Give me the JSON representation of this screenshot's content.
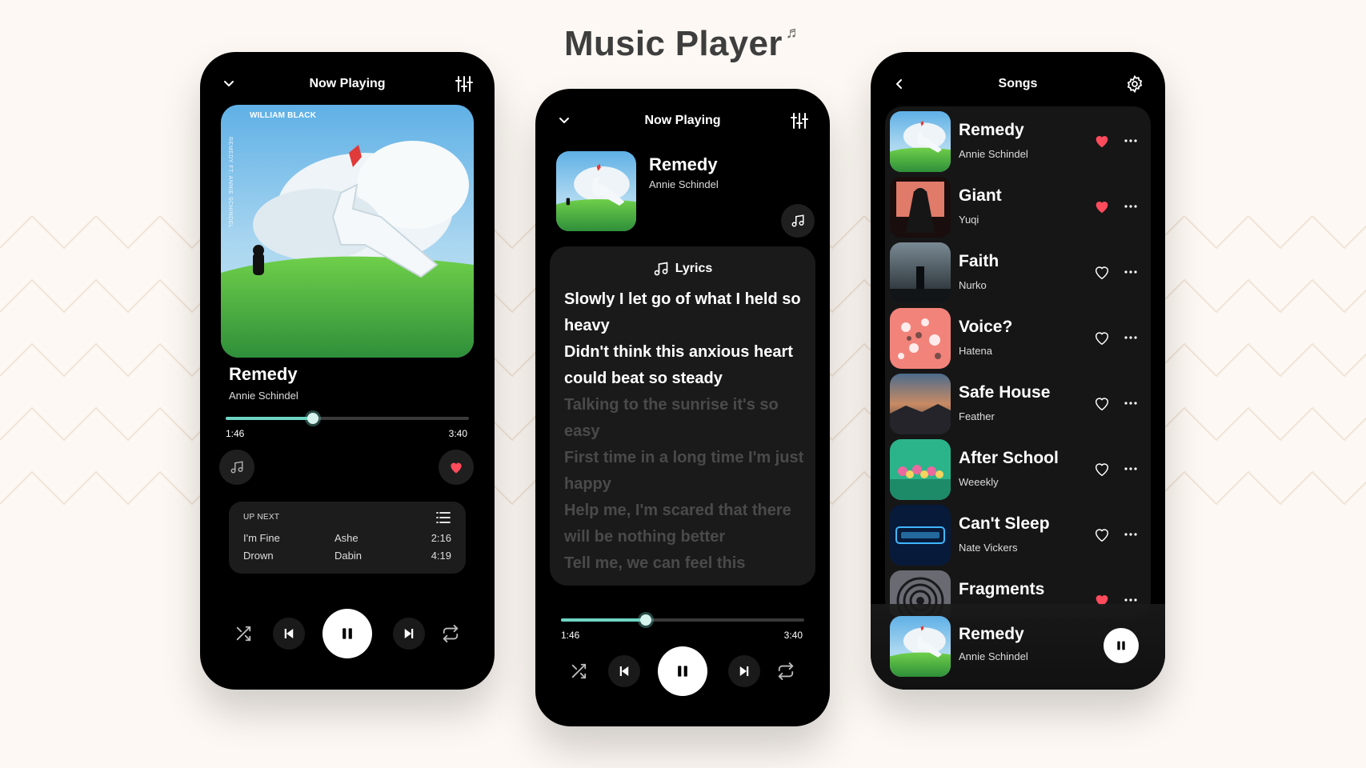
{
  "page": {
    "title": "Music Player"
  },
  "colors": {
    "accent": "#6fd4c4",
    "heart": "#ff4b5c",
    "background": "#fdf8f3",
    "panel": "#000000"
  },
  "now_playing_screen": {
    "title": "Now Playing",
    "album_label": "WILLIAM BLACK",
    "album_vertical_text": "REMEDY FT. ANNIE SCHINDEL",
    "song_title": "Remedy",
    "artist": "Annie Schindel",
    "current_time": "1:46",
    "total_time": "3:40",
    "progress": 0.36,
    "liked": true,
    "up_next": {
      "label": "UP NEXT",
      "rows": [
        {
          "title": "I'm Fine",
          "artist": "Ashe",
          "duration": "2:16"
        },
        {
          "title": "Drown",
          "artist": "Dabin",
          "duration": "4:19"
        }
      ]
    }
  },
  "lyrics_screen": {
    "title": "Now Playing",
    "song_title": "Remedy",
    "artist": "Annie Schindel",
    "lyrics_label": "Lyrics",
    "lyrics": [
      {
        "text": "Slowly I let go of what I held so heavy",
        "active": true
      },
      {
        "text": "Didn't think this anxious heart could beat so steady",
        "active": true
      },
      {
        "text": "Talking to the sunrise it's so easy",
        "active": false
      },
      {
        "text": "First time in a long time I'm just happy",
        "active": false
      },
      {
        "text": "Help me, I'm scared that there will be nothing better",
        "active": false
      },
      {
        "text": "Tell me, we can feel this",
        "active": false
      }
    ],
    "current_time": "1:46",
    "total_time": "3:40",
    "progress": 0.35
  },
  "songs_screen": {
    "title": "Songs",
    "songs": [
      {
        "title": "Remedy",
        "artist": "Annie Schindel",
        "liked": true
      },
      {
        "title": "Giant",
        "artist": "Yuqi",
        "liked": true
      },
      {
        "title": "Faith",
        "artist": "Nurko",
        "liked": false
      },
      {
        "title": "Voice?",
        "artist": "Hatena",
        "liked": false
      },
      {
        "title": "Safe House",
        "artist": "Feather",
        "liked": false
      },
      {
        "title": "After School",
        "artist": "Weeekly",
        "liked": false
      },
      {
        "title": "Can't Sleep",
        "artist": "Nate Vickers",
        "liked": false
      },
      {
        "title": "Fragments",
        "artist": "",
        "liked": true
      }
    ],
    "mini_player": {
      "song_title": "Remedy",
      "artist": "Annie Schindel"
    }
  }
}
